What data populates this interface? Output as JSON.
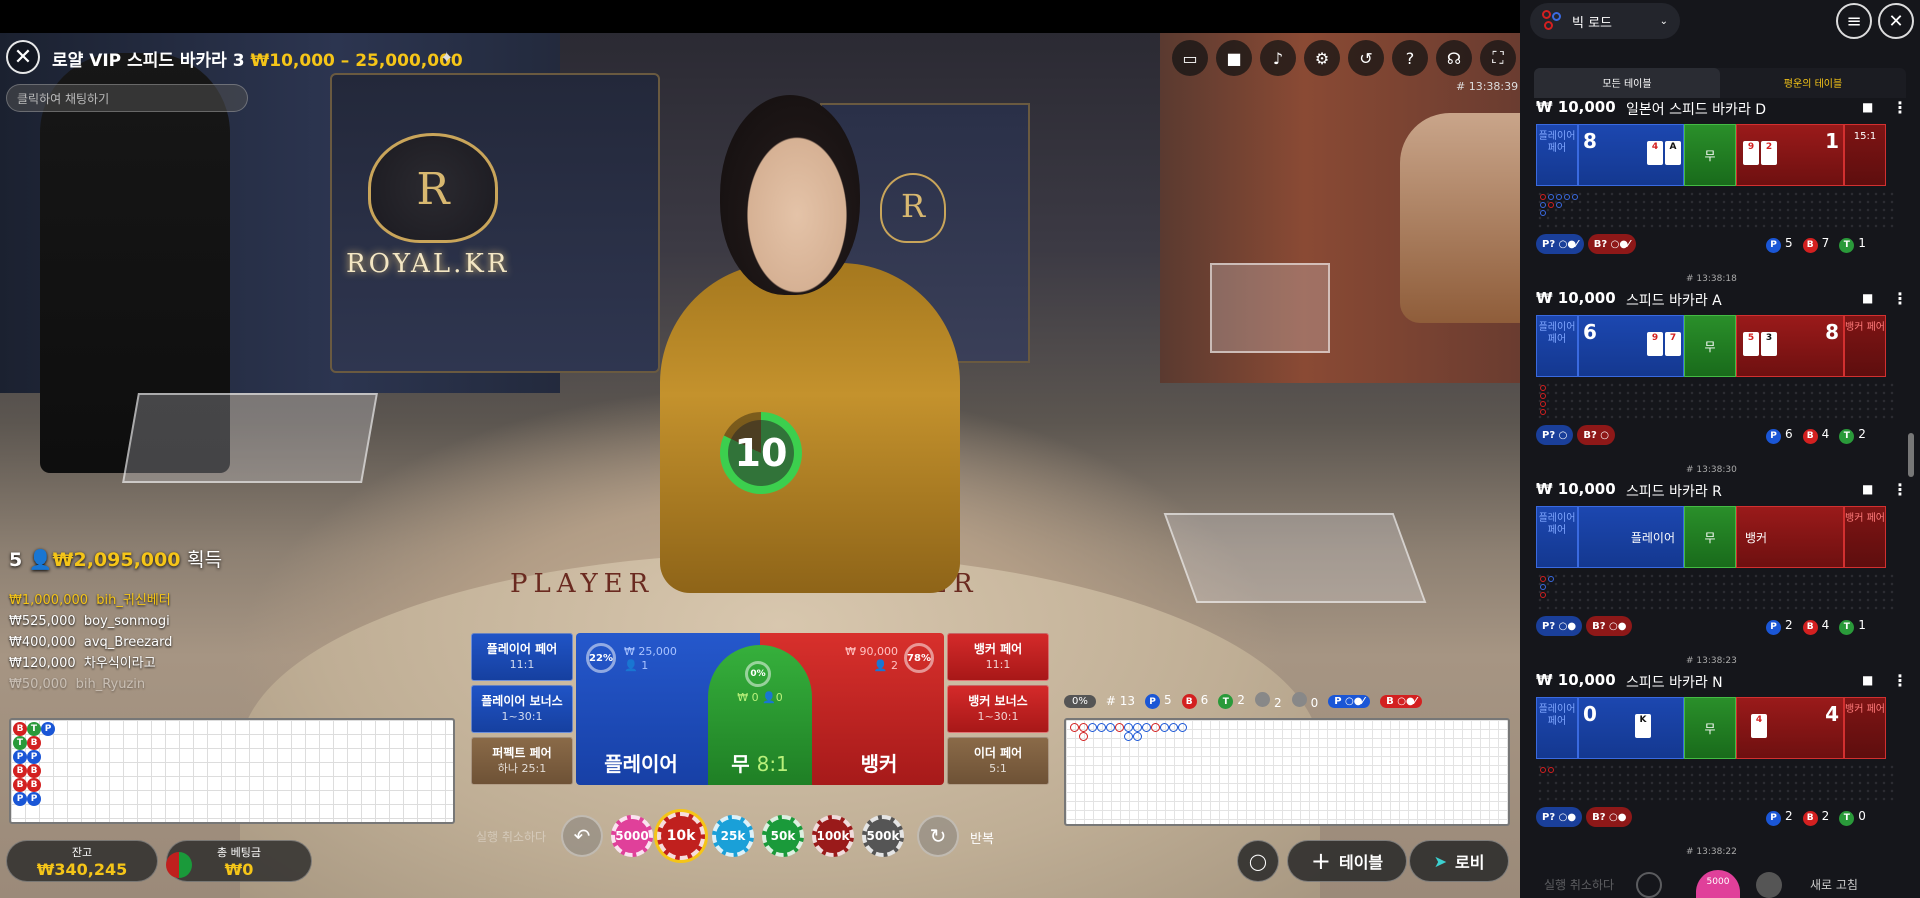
{
  "header": {
    "title": "로얄 VIP 스피드 바카라 3",
    "limits": "₩10,000 – 25,000,000",
    "chat_placeholder": "클릭하여 채팅하기",
    "clock": "# 13:38:39",
    "icons": [
      "chat-icon",
      "video-icon",
      "volume-icon",
      "settings-icon",
      "history-icon",
      "help-icon",
      "support-icon",
      "fullscreen-icon"
    ]
  },
  "scene": {
    "royal_text": "ROYAL.KR",
    "crest_letter": "R",
    "table_player": "PLAYER",
    "table_banker": "BANKER"
  },
  "timer": {
    "value": "10",
    "progress": 0.82
  },
  "winners": {
    "count": "5",
    "total": "₩2,095,000",
    "gain_label": "획득",
    "list": [
      {
        "amount": "₩1,000,000",
        "name": "bih_귀신베터"
      },
      {
        "amount": "₩525,000",
        "name": "boy_sonmogi"
      },
      {
        "amount": "₩400,000",
        "name": "avq_Breezard"
      },
      {
        "amount": "₩120,000",
        "name": "차우식이라고"
      },
      {
        "amount": "₩50,000",
        "name": "bih_Ryuzin"
      }
    ]
  },
  "bead_road": [
    [
      "B",
      "T",
      "P"
    ],
    [
      "T",
      "B"
    ],
    [
      "P",
      "P"
    ],
    [
      "B",
      "B"
    ],
    [
      "B",
      "B"
    ],
    [
      "P",
      "P"
    ]
  ],
  "bets": {
    "player_pair": {
      "label": "플레이어 페어",
      "odds": "11:1"
    },
    "player_bonus": {
      "label": "플레이어 보너스",
      "odds": "1~30:1"
    },
    "perfect_pair": {
      "label": "퍼펙트 페어",
      "odds": "하나 25:1"
    },
    "banker_pair": {
      "label": "뱅커 페어",
      "odds": "11:1"
    },
    "banker_bonus": {
      "label": "뱅커 보너스",
      "odds": "1~30:1"
    },
    "either_pair": {
      "label": "이더 페어",
      "odds": "5:1"
    },
    "player": {
      "label": "플레이어",
      "pct": "22%",
      "amount": "₩ 25,000",
      "players": "1"
    },
    "tie": {
      "label": "무",
      "odds": "8:1",
      "pct": "0%",
      "amount": "₩ 0",
      "players": "0"
    },
    "banker": {
      "label": "뱅커",
      "pct": "78%",
      "amount": "₩ 90,000",
      "players": "2"
    }
  },
  "chips": {
    "undo_label": "실행 취소하다",
    "repeat_label": "반복",
    "values": [
      "5000",
      "10k",
      "25k",
      "50k",
      "100k",
      "500k"
    ],
    "selected": "10k",
    "colors": [
      "#e0409a",
      "#c0201e",
      "#1aa0d8",
      "#1a9a3a",
      "#9a1a1a",
      "#555555"
    ]
  },
  "balance": {
    "label": "잔고",
    "value": "₩340,245"
  },
  "total_bet": {
    "label": "총 베팅금",
    "value": "₩0"
  },
  "buttons": {
    "table": "테이블",
    "lobby": "로비"
  },
  "stats": {
    "pct": "0%",
    "round": "# 13",
    "p": "5",
    "b": "6",
    "t": "2",
    "g1": "2",
    "g2": "0",
    "p_pred": "P",
    "b_pred": "B"
  },
  "panel": {
    "road_select": "빅 로드",
    "tabs": [
      "모든 테이블",
      "평운의 테이블"
    ],
    "tables": [
      {
        "stake": "₩ 10,000",
        "name": "일본어 스피드 바카라 D",
        "player_pair": "플레이어 페어",
        "banker_pair": "뱅커 페어",
        "tie": "무",
        "player_score": "8",
        "banker_score": "1",
        "player_cards": [
          "4",
          "A"
        ],
        "banker_cards": [
          "9",
          "2"
        ],
        "ratio": "15:1",
        "counts": {
          "p": "5",
          "b": "7",
          "t": "1"
        },
        "pred_p": "P?",
        "pred_b": "B?",
        "clock": "# 13:38:18"
      },
      {
        "stake": "₩ 10,000",
        "name": "스피드 바카라 A",
        "player_pair": "플레이어 페어",
        "banker_pair": "뱅커 페어",
        "tie": "무",
        "player_score": "6",
        "banker_score": "8",
        "player_cards": [
          "9",
          "7"
        ],
        "banker_cards": [
          "5",
          "3"
        ],
        "counts": {
          "p": "6",
          "b": "4",
          "t": "2"
        },
        "pred_p": "P?",
        "pred_b": "B?",
        "clock": "# 13:38:30"
      },
      {
        "stake": "₩ 10,000",
        "name": "스피드 바카라 R",
        "player_pair": "플레이어 페어",
        "banker_pair": "뱅커 페어",
        "tie": "무",
        "player_text": "플레이어",
        "banker_text": "뱅커",
        "counts": {
          "p": "2",
          "b": "4",
          "t": "1"
        },
        "pred_p": "P?",
        "pred_b": "B?",
        "clock": "# 13:38:23"
      },
      {
        "stake": "₩ 10,000",
        "name": "스피드 바카라 N",
        "player_pair": "플레이어 페어",
        "banker_pair": "뱅커 페어",
        "tie": "무",
        "player_score": "0",
        "banker_score": "4",
        "player_cards": [
          "K"
        ],
        "banker_cards": [
          "4"
        ],
        "counts": {
          "p": "2",
          "b": "2",
          "t": "0"
        },
        "pred_p": "P?",
        "pred_b": "B?",
        "clock": "# 13:38:22"
      }
    ],
    "bottom_undo": "실행 취소하다",
    "bottom_chip": "5000",
    "bottom_text": "새로 고침"
  }
}
